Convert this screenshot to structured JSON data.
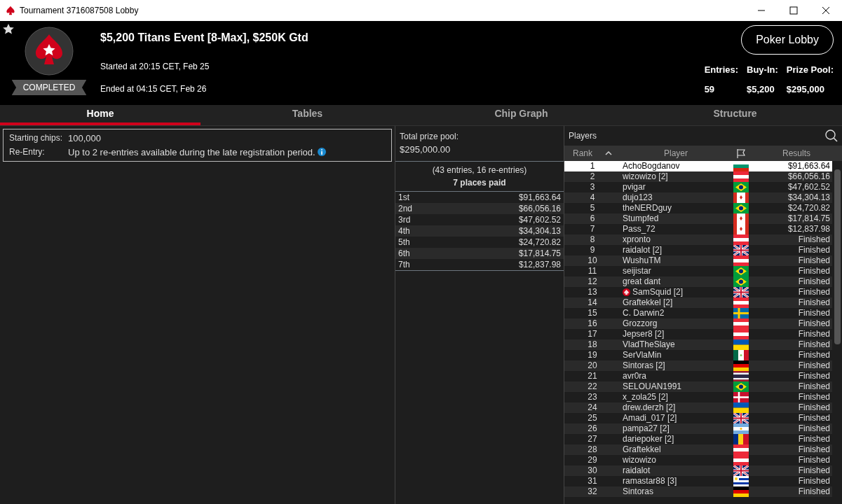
{
  "window": {
    "title": "Tournament 3716087508 Lobby"
  },
  "header": {
    "favorite": true,
    "status": "COMPLETED",
    "event_title": "$5,200 Titans Event [8-Max], $250K Gtd",
    "started": "Started at 20:15 CET, Feb 25",
    "ended": "Ended at 04:15 CET, Feb 26",
    "lobby_button": "Poker Lobby",
    "stats": [
      {
        "label": "Entries:",
        "value": "59"
      },
      {
        "label": "Buy-In:",
        "value": "$5,200"
      },
      {
        "label": "Prize Pool:",
        "value": "$295,000"
      }
    ]
  },
  "tabs": [
    {
      "label": "Home",
      "selected": true
    },
    {
      "label": "Tables",
      "selected": false
    },
    {
      "label": "Chip Graph",
      "selected": false
    },
    {
      "label": "Structure",
      "selected": false
    }
  ],
  "info": [
    {
      "label": "Starting chips:",
      "value": "100,000",
      "info_icon": false
    },
    {
      "label": "Re-Entry:",
      "value": "Up to 2 re-entries available during the late registration period.",
      "info_icon": true
    }
  ],
  "prizes": {
    "total_label": "Total prize pool:",
    "total": "$295,000.00",
    "entries": "(43 entries, 16 re-entries)",
    "places": "7 places paid",
    "rows": [
      {
        "place": "1st",
        "amount": "$91,663.64"
      },
      {
        "place": "2nd",
        "amount": "$66,056.16"
      },
      {
        "place": "3rd",
        "amount": "$47,602.52"
      },
      {
        "place": "4th",
        "amount": "$34,304.13"
      },
      {
        "place": "5th",
        "amount": "$24,720.82"
      },
      {
        "place": "6th",
        "amount": "$17,814.75"
      },
      {
        "place": "7th",
        "amount": "$12,837.98"
      }
    ]
  },
  "players": {
    "title": "Players",
    "columns": [
      "Rank",
      "Player",
      "Results"
    ],
    "rows": [
      {
        "rank": "1",
        "player": "AchoBogdanov",
        "kind": "bg",
        "result": "$91,663.64",
        "selected": true
      },
      {
        "rank": "2",
        "player": "wizowizo [2]",
        "kind": "at",
        "result": "$66,056.16",
        "selected": false
      },
      {
        "rank": "3",
        "player": "pvigar",
        "kind": "br",
        "result": "$47,602.52",
        "selected": false
      },
      {
        "rank": "4",
        "player": "dujo123",
        "kind": "ca",
        "result": "$34,304.13",
        "selected": false
      },
      {
        "rank": "5",
        "player": "theNERDguy",
        "kind": "br",
        "result": "$24,720.82",
        "selected": false
      },
      {
        "rank": "6",
        "player": "Stumpfed",
        "kind": "ca",
        "result": "$17,814.75",
        "selected": false
      },
      {
        "rank": "7",
        "player": "Pass_72",
        "kind": "ca",
        "result": "$12,837.98",
        "selected": false
      },
      {
        "rank": "8",
        "player": "xpronto",
        "kind": "at",
        "result": "Finished",
        "selected": false
      },
      {
        "rank": "9",
        "player": "raidalot [2]",
        "kind": "gb",
        "result": "Finished",
        "selected": false
      },
      {
        "rank": "10",
        "player": "WushuTM",
        "kind": "at",
        "result": "Finished",
        "selected": false
      },
      {
        "rank": "11",
        "player": "seijistar",
        "kind": "br",
        "result": "Finished",
        "selected": false
      },
      {
        "rank": "12",
        "player": "great dant",
        "kind": "br",
        "result": "Finished",
        "selected": false
      },
      {
        "rank": "13",
        "player": "SamSquid [2]",
        "kind": "gb",
        "result": "Finished",
        "selected": false,
        "pro": true
      },
      {
        "rank": "14",
        "player": "Graftekkel [2]",
        "kind": "at",
        "result": "Finished",
        "selected": false
      },
      {
        "rank": "15",
        "player": "C. Darwin2",
        "kind": "se",
        "result": "Finished",
        "selected": false
      },
      {
        "rank": "16",
        "player": "Grozzorg",
        "kind": "at",
        "result": "Finished",
        "selected": false
      },
      {
        "rank": "17",
        "player": "Jepser8 [2]",
        "kind": "at",
        "result": "Finished",
        "selected": false
      },
      {
        "rank": "18",
        "player": "VladTheSlaye",
        "kind": "ua",
        "result": "Finished",
        "selected": false
      },
      {
        "rank": "19",
        "player": "SerVlaMin",
        "kind": "mx",
        "result": "Finished",
        "selected": false
      },
      {
        "rank": "20",
        "player": "Sintoras [2]",
        "kind": "de",
        "result": "Finished",
        "selected": false
      },
      {
        "rank": "21",
        "player": "avr0ra",
        "kind": "th",
        "result": "Finished",
        "selected": false
      },
      {
        "rank": "22",
        "player": "SELOUAN1991",
        "kind": "br",
        "result": "Finished",
        "selected": false
      },
      {
        "rank": "23",
        "player": "x_zola25 [2]",
        "kind": "dk",
        "result": "Finished",
        "selected": false
      },
      {
        "rank": "24",
        "player": "drew.derzh [2]",
        "kind": "ua",
        "result": "Finished",
        "selected": false
      },
      {
        "rank": "25",
        "player": "Amadi_017 [2]",
        "kind": "gb",
        "result": "Finished",
        "selected": false
      },
      {
        "rank": "26",
        "player": "pampa27 [2]",
        "kind": "ar",
        "result": "Finished",
        "selected": false
      },
      {
        "rank": "27",
        "player": "dariepoker [2]",
        "kind": "ro",
        "result": "Finished",
        "selected": false
      },
      {
        "rank": "28",
        "player": "Graftekkel",
        "kind": "at",
        "result": "Finished",
        "selected": false
      },
      {
        "rank": "29",
        "player": "wizowizo",
        "kind": "at",
        "result": "Finished",
        "selected": false
      },
      {
        "rank": "30",
        "player": "raidalot",
        "kind": "gb",
        "result": "Finished",
        "selected": false
      },
      {
        "rank": "31",
        "player": "ramastar88 [3]",
        "kind": "uy",
        "result": "Finished",
        "selected": false
      },
      {
        "rank": "32",
        "player": "Sintoras",
        "kind": "de",
        "result": "Finished",
        "selected": false
      }
    ]
  }
}
